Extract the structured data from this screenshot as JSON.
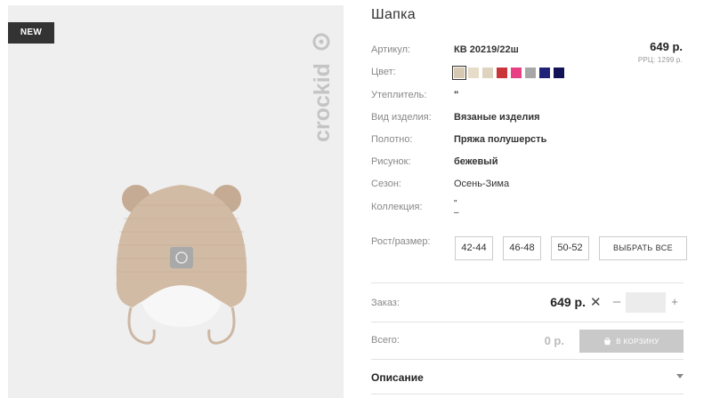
{
  "badge": "NEW",
  "brand": "crockid",
  "product": {
    "title": "Шапка"
  },
  "price": {
    "main": "649 р.",
    "rrp": "РРЦ: 1299 р."
  },
  "attributes": {
    "article_label": "Артикул:",
    "article_value": "КВ 20219/22ш",
    "color_label": "Цвет:",
    "insulation_label": "Утеплитель:",
    "insulation_value": "\"",
    "type_label": "Вид изделия:",
    "type_value": "Вязаные изделия",
    "fabric_label": "Полотно:",
    "fabric_value": "Пряжа полушерсть",
    "pattern_label": "Рисунок:",
    "pattern_value": "бежевый",
    "season_label": "Сезон:",
    "season_value": "Осень-Зима",
    "collection_label": "Коллекция:",
    "collection_value_1": "\"",
    "collection_value_2": "–"
  },
  "colors": [
    "#d7c8b1",
    "#e6dcc8",
    "#ddd3bf",
    "#c93639",
    "#e83e84",
    "#a7a7a7",
    "#1f2378",
    "#121257"
  ],
  "size_label": "Рост/размер:",
  "sizes": [
    "42-44",
    "46-48",
    "50-52"
  ],
  "select_all": "ВЫБРАТЬ ВСЕ",
  "order": {
    "label": "Заказ:",
    "price": "649 р.",
    "times": "✕",
    "minus": "–",
    "plus": "+",
    "quantity": ""
  },
  "total": {
    "label": "Всего:",
    "value": "0 р.",
    "cart_button": "В КОРЗИНУ"
  },
  "description_title": "Описание"
}
